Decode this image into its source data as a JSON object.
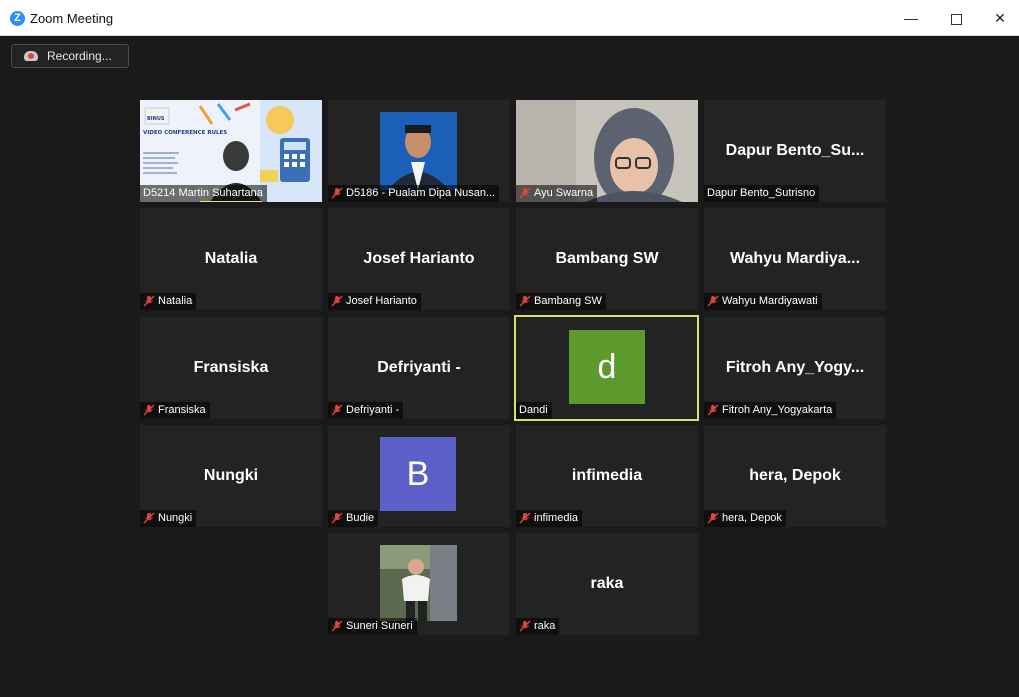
{
  "window": {
    "title": "Zoom Meeting",
    "logo_letter": "Z"
  },
  "controls": {
    "minimize": "—",
    "close": "✕"
  },
  "recording": {
    "label": "Recording..."
  },
  "colors": {
    "background": "#1a1a1a",
    "tile": "#232323",
    "active_border": "#d7e26a",
    "mic_muted": "#e0453a"
  },
  "participants": [
    {
      "label": "D5214 Martin Suhartana",
      "video": true,
      "muted": false
    },
    {
      "label": "D5186 - Pualam Dipa Nusan...",
      "video": true,
      "muted": true
    },
    {
      "label": "Ayu Swarna",
      "video": true,
      "muted": true
    },
    {
      "big_name": "Dapur Bento_Su...",
      "label": "Dapur Bento_Sutrisno",
      "muted": false
    },
    {
      "big_name": "Natalia",
      "label": "Natalia",
      "muted": true
    },
    {
      "big_name": "Josef Harianto",
      "label": "Josef Harianto",
      "muted": true
    },
    {
      "big_name": "Bambang SW",
      "label": "Bambang SW",
      "muted": true
    },
    {
      "big_name": "Wahyu Mardiya...",
      "label": "Wahyu Mardiyawati",
      "muted": true
    },
    {
      "big_name": "Fransiska",
      "label": "Fransiska",
      "muted": true
    },
    {
      "big_name": "Defriyanti -",
      "label": "Defriyanti -",
      "muted": true
    },
    {
      "avatar_letter": "d",
      "avatar_color": "#5c9a2e",
      "label": "Dandi",
      "muted": false,
      "active": true
    },
    {
      "big_name": "Fitroh Any_Yogy...",
      "label": "Fitroh Any_Yogyakarta",
      "muted": true
    },
    {
      "big_name": "Nungki",
      "label": "Nungki",
      "muted": true
    },
    {
      "avatar_letter": "B",
      "avatar_color": "#5b5fc7",
      "label": "Budie",
      "muted": true
    },
    {
      "big_name": "infimedia",
      "label": "infimedia",
      "muted": true
    },
    {
      "big_name": "hera, Depok",
      "label": "hera, Depok",
      "muted": true
    },
    {
      "label": "Suneri Suneri",
      "video": true,
      "muted": true
    },
    {
      "big_name": "raka",
      "label": "raka",
      "muted": true
    }
  ],
  "slide": {
    "title": "VIDEO CONFERENCE RULES",
    "brand": "BINUS"
  }
}
